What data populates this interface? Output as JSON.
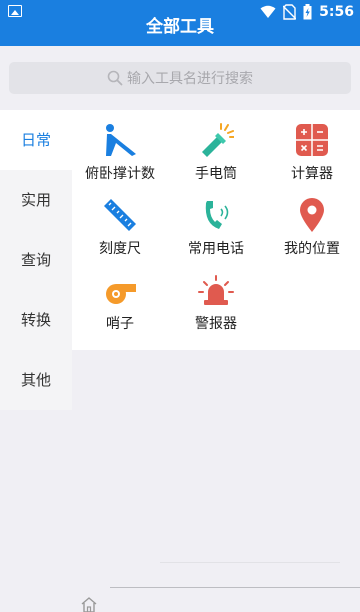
{
  "status_bar": {
    "time": "5:56",
    "icons": [
      "image-icon",
      "wifi-icon",
      "no-sim-icon",
      "battery-icon"
    ]
  },
  "header": {
    "title": "全部工具"
  },
  "search": {
    "placeholder": "输入工具名进行搜索"
  },
  "sidebar": {
    "active_index": 0,
    "items": [
      {
        "label": "日常"
      },
      {
        "label": "实用"
      },
      {
        "label": "查询"
      },
      {
        "label": "转换"
      },
      {
        "label": "其他"
      }
    ]
  },
  "tools": [
    {
      "label": "俯卧撑计数",
      "icon": "pushup-icon"
    },
    {
      "label": "手电筒",
      "icon": "flashlight-icon"
    },
    {
      "label": "计算器",
      "icon": "calculator-icon"
    },
    {
      "label": "刻度尺",
      "icon": "ruler-icon"
    },
    {
      "label": "常用电话",
      "icon": "phone-icon"
    },
    {
      "label": "我的位置",
      "icon": "location-pin-icon"
    },
    {
      "label": "哨子",
      "icon": "whistle-icon"
    },
    {
      "label": "警报器",
      "icon": "alarm-siren-icon"
    }
  ],
  "colors": {
    "primary": "#1a7fe0",
    "active_tab": "#1a7fe0",
    "calculator": "#e05a4f",
    "location": "#e05a4f",
    "whistle": "#f59a2a",
    "phone": "#2bb39a",
    "flashlight": "#f5a623",
    "alarm": "#e05a4f"
  }
}
